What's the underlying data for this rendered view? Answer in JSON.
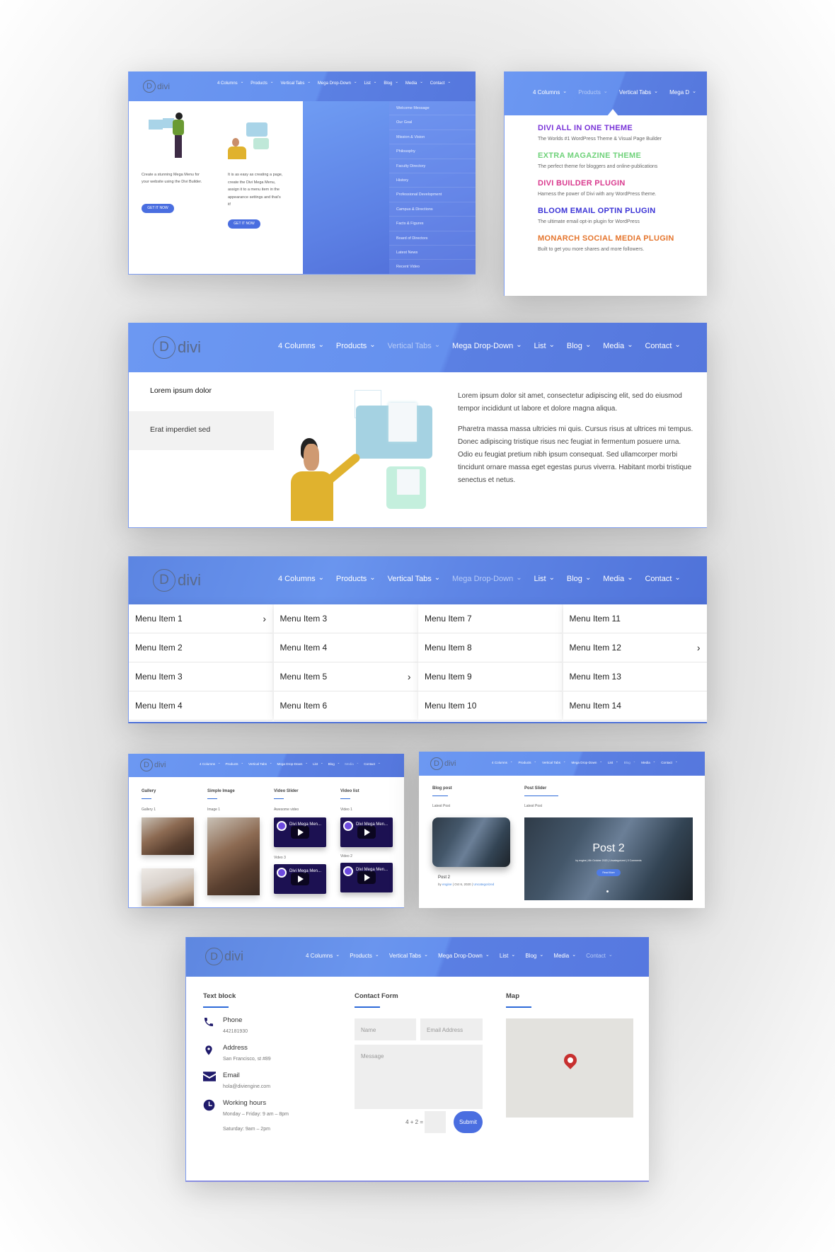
{
  "logo_text": "divi",
  "logo_letter": "D",
  "nav": [
    "4 Columns",
    "Products",
    "Vertical Tabs",
    "Mega Drop-Down",
    "List",
    "Blog",
    "Media",
    "Contact"
  ],
  "panel1": {
    "col1_text": "Create a stunning Mega Menu for your website using the Divi Builder.",
    "col2_text": "It is as easy as creating a page, create the Divi Mega Menu, assign it to a menu item in the appearance settings and that's it!",
    "cta": "GET IT NOW",
    "dropdown": [
      "Welcome Message",
      "Our Goal",
      "Mission & Vision",
      "Philosophy",
      "Faculty Directory",
      "History",
      "Professional Development",
      "Campus & Directions",
      "Facts & Figures",
      "Board of Directors",
      "Latest News",
      "Recent Video"
    ]
  },
  "panel2": {
    "nav": [
      "4 Columns",
      "Products",
      "Vertical Tabs",
      "Mega D"
    ],
    "products": [
      {
        "title": "DIVI ALL IN ONE THEME",
        "desc": "The Worlds #1 WordPress Theme & Visual Page Builder",
        "color": "#7a35d8"
      },
      {
        "title": "EXTRA MAGAZINE THEME",
        "desc": "The perfect theme for bloggers and online-publications",
        "color": "#6fd27a"
      },
      {
        "title": "DIVI BUILDER PLUGIN",
        "desc": "Harness the power of Divi with any WordPress theme.",
        "color": "#d93a8e"
      },
      {
        "title": "BLOOM EMAIL OPTIN PLUGIN",
        "desc": "The ultimate email opt-in plugin for WordPress",
        "color": "#3a32d6"
      },
      {
        "title": "MONARCH SOCIAL MEDIA PLUGIN",
        "desc": "Built to get you more shares and more followers.",
        "color": "#e5752d"
      }
    ]
  },
  "panel3": {
    "tabs": [
      "Lorem ipsum dolor",
      "Erat imperdiet sed"
    ],
    "para1": "Lorem ipsum dolor sit amet, consectetur adipiscing elit, sed do eiusmod tempor incididunt ut labore et dolore magna aliqua.",
    "para2": "Pharetra massa massa ultricies mi quis. Cursus risus at ultrices mi tempus. Donec adipiscing tristique risus nec feugiat in fermentum posuere urna. Odio eu feugiat pretium nibh ipsum consequat. Sed ullamcorper morbi tincidunt ornare massa eget egestas purus viverra. Habitant morbi tristique senectus et netus."
  },
  "panel4": {
    "columns": [
      [
        "Menu Item 1",
        "Menu Item 2",
        "Menu Item 3",
        "Menu Item 4"
      ],
      [
        "Menu Item 3",
        "Menu Item 4",
        "Menu Item 5",
        "Menu Item 6"
      ],
      [
        "Menu Item 7",
        "Menu Item 8",
        "Menu Item 9",
        "Menu Item 10"
      ],
      [
        "Menu Item 11",
        "Menu Item 12",
        "Menu Item 13",
        "Menu Item 14"
      ]
    ]
  },
  "panel5a": {
    "sections": [
      {
        "title": "Gallery",
        "sub": "Gallery 1"
      },
      {
        "title": "Simple Image",
        "sub": "Image 1"
      },
      {
        "title": "Video Slider",
        "sub": "Awesome video",
        "sub2": "Video 3"
      },
      {
        "title": "Video list",
        "sub": "Video 1",
        "sub2": "Video 2"
      }
    ],
    "video_title": "Divi Mega Men..."
  },
  "panel5b": {
    "blog_title": "Blog post",
    "slider_title": "Post Slider",
    "latest": "Latest Post",
    "post_title": "Post 2",
    "post_meta_by": "by",
    "post_author": "engine",
    "post_date": "| Oct 6, 2020 |",
    "post_cat": "Uncategorized",
    "slide_meta": "by engine | 6th October 2020 | Uncategorized | 0 Comments",
    "read_more": "Read More"
  },
  "panel6": {
    "text_block": "Text block",
    "contact_form": "Contact Form",
    "map": "Map",
    "contacts": [
      {
        "label": "Phone",
        "value": "442181930"
      },
      {
        "label": "Address",
        "value": "San Francisco, st #89"
      },
      {
        "label": "Email",
        "value": "hola@diviengine.com"
      },
      {
        "label": "Working hours",
        "value": "Monday – Friday: 9 am – 8pm",
        "value2": "Saturday: 9am – 2pm"
      }
    ],
    "name_ph": "Name",
    "email_ph": "Email Address",
    "message_ph": "Message",
    "captcha": "4 + 2 =",
    "submit": "Submit"
  },
  "colors": {
    "accent": "#4a6ee0",
    "header": "#6590ee",
    "icon": "#1f1a6b"
  }
}
